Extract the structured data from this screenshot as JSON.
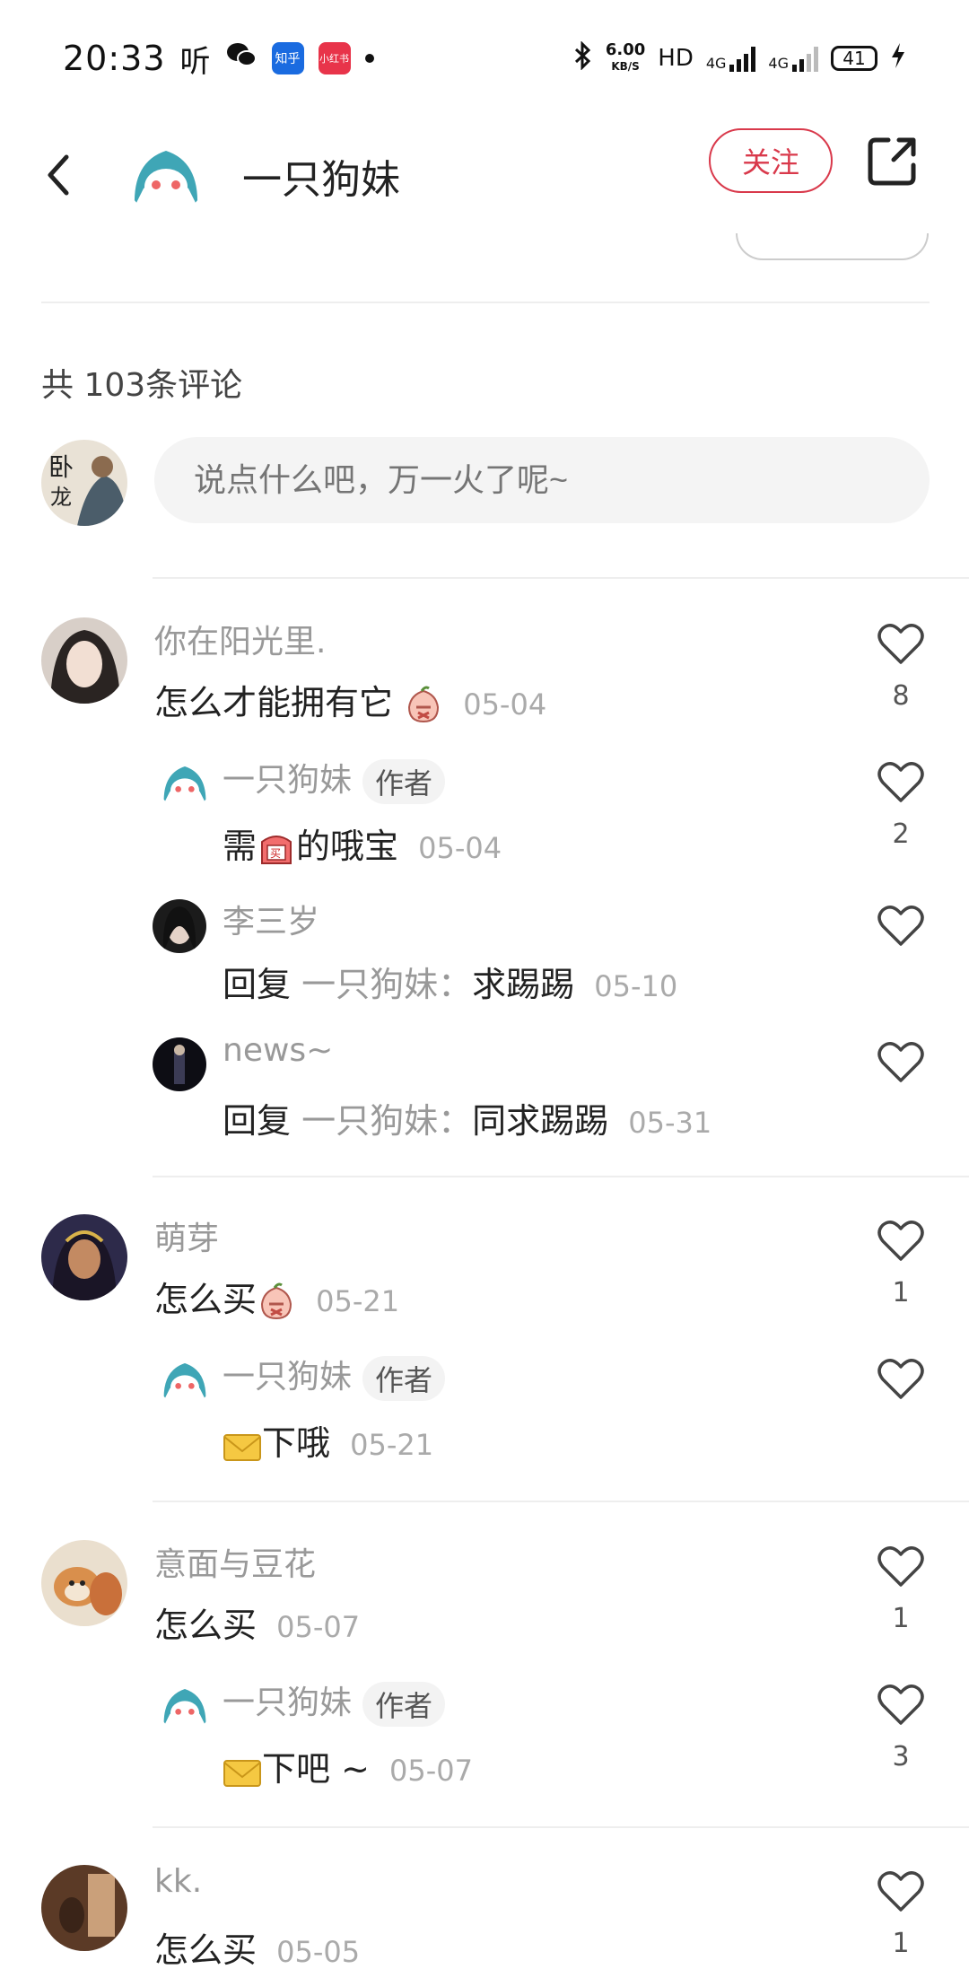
{
  "status_bar": {
    "time": "20:33",
    "listen_glyph": "听",
    "zhihu_label": "知乎",
    "xhs_label": "小红书",
    "speed_value": "6.00",
    "speed_unit": "KB/S",
    "hd_label": "HD",
    "net1": "4G",
    "net2": "4G",
    "battery": "41"
  },
  "header": {
    "author_name": "一只狗妹",
    "follow_label": "关注"
  },
  "comments_header": {
    "count_label": "共 103条评论",
    "input_placeholder": "说点什么吧，万一火了呢~"
  },
  "comments": [
    {
      "user": "你在阳光里.",
      "text": "怎么才能拥有它",
      "date": "05-04",
      "likes": "8",
      "replies": [
        {
          "user": "一只狗妹",
          "tag": "作者",
          "text_pre": "需",
          "text_post": "的哦宝",
          "date": "05-04",
          "likes": "2"
        },
        {
          "user": "李三岁",
          "reply_prefix": "回复",
          "reply_target": "一只狗妹：",
          "text": "求踢踢",
          "date": "05-10",
          "likes": ""
        },
        {
          "user": "news~",
          "reply_prefix": "回复",
          "reply_target": "一只狗妹：",
          "text": "同求踢踢",
          "date": "05-31",
          "likes": ""
        }
      ]
    },
    {
      "user": "萌芽",
      "text": "怎么买",
      "date": "05-21",
      "likes": "1",
      "replies": [
        {
          "user": "一只狗妹",
          "tag": "作者",
          "text": "下哦",
          "date": "05-21",
          "likes": ""
        }
      ]
    },
    {
      "user": "意面与豆花",
      "text": "怎么买",
      "date": "05-07",
      "likes": "1",
      "replies": [
        {
          "user": "一只狗妹",
          "tag": "作者",
          "text": "下吧 ~",
          "date": "05-07",
          "likes": "3"
        }
      ]
    },
    {
      "user": "kk.",
      "text": "怎么买",
      "date": "05-05",
      "likes": "1",
      "replies": []
    }
  ],
  "colors": {
    "accent": "#d9394b",
    "muted_text": "#999999",
    "input_bg": "#f4f4f4"
  }
}
